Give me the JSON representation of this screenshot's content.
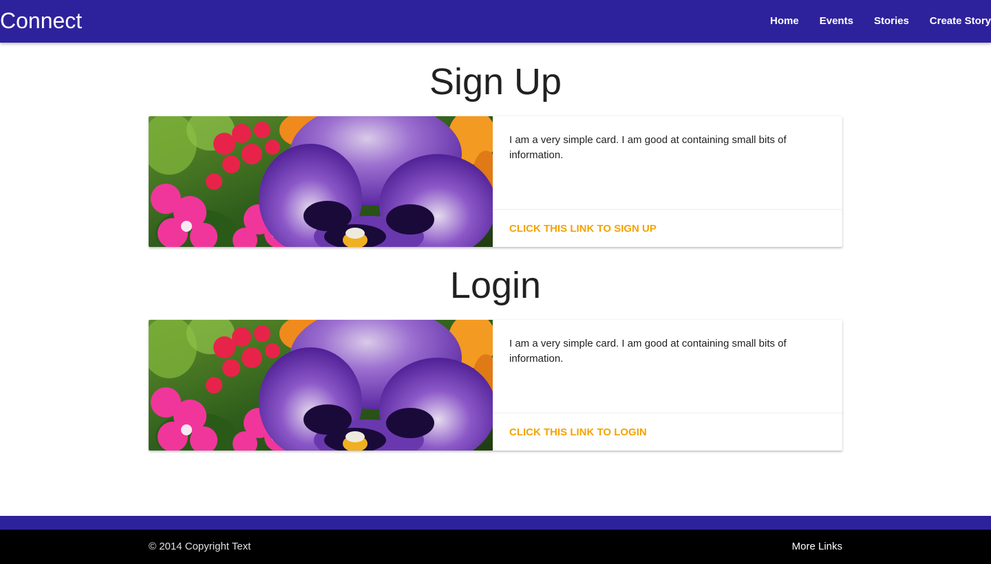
{
  "navbar": {
    "brand": "Connect",
    "links": [
      "Home",
      "Events",
      "Stories",
      "Create Story"
    ],
    "background": "#2e229c"
  },
  "sections": [
    {
      "title": "Sign Up",
      "card": {
        "text": "I am a very simple card. I am good at containing small bits of information.",
        "link": "CLICK THIS LINK TO SIGN UP",
        "image": "pansy-flower-image"
      }
    },
    {
      "title": "Login",
      "card": {
        "text": "I am a very simple card. I am good at containing small bits of information.",
        "link": "CLICK THIS LINK TO LOGIN",
        "image": "pansy-flower-image"
      }
    }
  ],
  "footer": {
    "copyright": "© 2014 Copyright Text",
    "more_links": "More Links"
  },
  "colors": {
    "accent_link": "#f5a300",
    "footer_band": "#2e229c",
    "footer_bar": "#000000"
  }
}
